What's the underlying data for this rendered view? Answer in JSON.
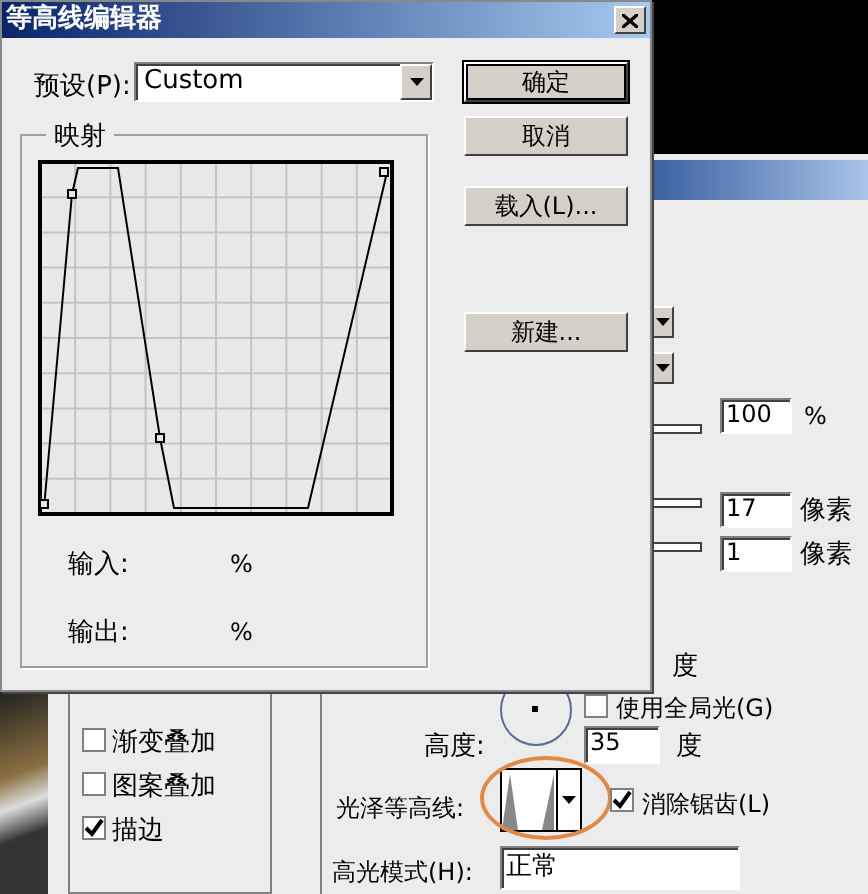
{
  "contour_editor": {
    "title": "等高线编辑器",
    "preset_label": "预设(P):",
    "preset_value": "Custom",
    "mapping_group": "映射",
    "input_label": "输入:",
    "input_unit": "%",
    "output_label": "输出:",
    "output_unit": "%",
    "buttons": [
      {
        "label": "确定",
        "default": true
      },
      {
        "label": "取消",
        "default": false
      },
      {
        "label": "载入(L)...",
        "default": false
      },
      {
        "label": "新建...",
        "default": false
      }
    ]
  },
  "layer_style": {
    "styles_list": [
      {
        "label": "渐变叠加",
        "checked": false
      },
      {
        "label": "图案叠加",
        "checked": false
      },
      {
        "label": "描边",
        "checked": true
      }
    ],
    "opacity": {
      "value": "100",
      "unit": "%"
    },
    "size_fields": [
      {
        "value": "17",
        "unit": "像素"
      },
      {
        "value": "1",
        "unit": "像素"
      }
    ],
    "angle_unit": "度",
    "use_global_light": {
      "label": "使用全局光(G)",
      "checked": false
    },
    "altitude": {
      "label": "高度:",
      "value": "35",
      "unit": "度"
    },
    "gloss_contour": {
      "label": "光泽等高线:"
    },
    "anti_alias": {
      "label": "消除锯齿(L)",
      "checked": true
    },
    "highlight_mode": {
      "label": "高光模式(H):",
      "value": "正常"
    }
  }
}
